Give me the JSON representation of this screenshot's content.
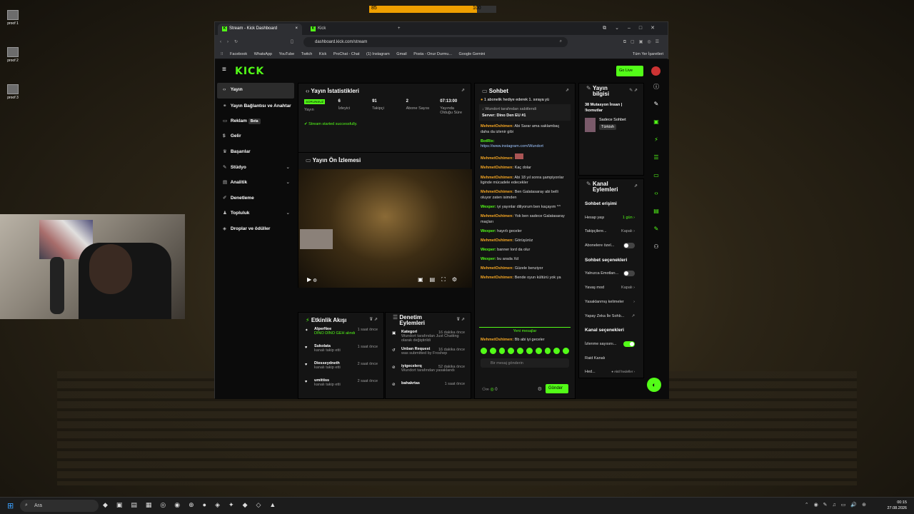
{
  "overlay": {
    "left": "85",
    "right": "100"
  },
  "desktop": {
    "icons": [
      "proof 1",
      "proof 2",
      "proof 3"
    ]
  },
  "browser": {
    "tabs": [
      {
        "label": "Stream - Kick Dashboard",
        "close": "×"
      },
      {
        "label": "Kick"
      }
    ],
    "new_tab": "+",
    "url": "dashboard.kick.com/stream",
    "bookmarks": [
      "Facebook",
      "WhatsApp",
      "YouTube",
      "Twitch",
      "Kick",
      "ProChat - Chat",
      "(1) Instagram",
      "Gmail",
      "Posta - Onur Durmu...",
      "Google Gemini"
    ],
    "bookmarks_folder": "Tüm Yer İşaretleri"
  },
  "kick": {
    "logo": "KICK",
    "go_live": "Go Live",
    "sidebar": [
      {
        "label": "Yayın",
        "icon": "stream-icon",
        "selected": true
      },
      {
        "label": "Yayın Bağlantısı ve Anahtar",
        "icon": "link-icon"
      },
      {
        "label": "Reklam",
        "icon": "ad-icon",
        "badge": "Beta"
      },
      {
        "label": "Gelir",
        "icon": "dollar-icon"
      },
      {
        "label": "Başarılar",
        "icon": "trophy-icon"
      },
      {
        "label": "Stüdyo",
        "icon": "studio-icon",
        "chevron": "⌄"
      },
      {
        "label": "Analitik",
        "icon": "analytics-icon",
        "chevron": "⌄"
      },
      {
        "label": "Denetleme",
        "icon": "moderation-icon"
      },
      {
        "label": "Topluluk",
        "icon": "community-icon",
        "chevron": "⌄"
      },
      {
        "label": "Droplar ve ödüller",
        "icon": "drops-icon"
      }
    ],
    "stats": {
      "title": "Yayın İstatistikleri",
      "badge": "SORUNSUZ",
      "items": [
        {
          "value": "",
          "label": "Yayın"
        },
        {
          "value": "6",
          "label": "İzleyici"
        },
        {
          "value": "91",
          "label": "Takipçi"
        },
        {
          "value": "2",
          "label": "Abone Sayısı"
        },
        {
          "value": "07:13:00",
          "label": "Yayında Olduğu Süre"
        }
      ],
      "status": "Stream started successfully."
    },
    "preview": {
      "title": "Yayın Ön İzlemesi"
    },
    "activity": {
      "title": "Etkinlik Akışı",
      "rows": [
        {
          "name": "AlperNee",
          "sub": "DİNO DİNO GEH alındı",
          "time": "1 saat önce"
        },
        {
          "name": "Sukolata",
          "sub": "kanalı takip etti",
          "time": "1 saat önce"
        },
        {
          "name": "Diesseydneth",
          "sub": "kanalı takip etti",
          "time": "2 saat önce"
        },
        {
          "name": "umittiss",
          "sub": "kanalı takip etti",
          "time": "2 saat önce"
        }
      ]
    },
    "moderation": {
      "title": "Denetim Eylemleri",
      "rows": [
        {
          "name": "Kategori",
          "sub": "Wundort tarafından Just Chatting olarak değiştirildi",
          "time": "16 dakika önce"
        },
        {
          "name": "Unban Request",
          "sub": "was submitted by Froshep",
          "time": "16 dakika önce"
        },
        {
          "name": "iyigecelerq",
          "sub": "Wundort tarafından yasaklandı",
          "time": "52 dakika önce"
        },
        {
          "name": "bahakrtas",
          "sub": "",
          "time": "1 saat önce"
        }
      ]
    },
    "chat": {
      "title": "Sohbet",
      "gift_banner": "1 abonelik hediye ederek 1. sıraya yü",
      "pinned_by": "Wundort tarafından sabitlendi",
      "pinned_msg": "Server: Dino Den EU #1",
      "messages": [
        {
          "user": "MehmetOshimen:",
          "text": "Abi Sarar ama saklambaç daha da izlenir gibi",
          "c": "u"
        },
        {
          "user": "BotRix:",
          "text": "https://www.instagram.com/Wundort",
          "c": "b"
        },
        {
          "user": "MehmetOshimen:",
          "text": "",
          "c": "u"
        },
        {
          "user": "MehmetOshimen:",
          "text": "Kaç dolar",
          "c": "u"
        },
        {
          "user": "MehmetOshimen:",
          "text": "Abi 18 yıl sonra şampiyonlar liginde mücadele edecekler",
          "c": "u"
        },
        {
          "user": "MehmetOshimen:",
          "text": "Ben Galatasaray abi belli oluyor zaten isimden",
          "c": "u"
        },
        {
          "user": "Wexper:",
          "text": "iyi yayınlar diliyorum ben kaçayım ^^",
          "c": "g"
        },
        {
          "user": "MehmetOshimen:",
          "text": "Yok ben sadece Galatasaray maçları",
          "c": "u"
        },
        {
          "user": "Wexper:",
          "text": "hayırlı geceler",
          "c": "g"
        },
        {
          "user": "MehmetOshimen:",
          "text": "Görüşürüz",
          "c": "u"
        },
        {
          "user": "Wexper:",
          "text": "banner lord da olur",
          "c": "g"
        },
        {
          "user": "Wexper:",
          "text": "bu arada Xd",
          "c": "g"
        },
        {
          "user": "MehmetOshimen:",
          "text": "Güzele benziyor",
          "c": "u"
        },
        {
          "user": "MehmetOshimen:",
          "text": "Bende oyun kültürü yok ya",
          "c": "u"
        }
      ],
      "new_messages": "Yeni mesajlar",
      "last": {
        "user": "MehmetOshimen:",
        "text": "Bb abi iyi geceler"
      },
      "input_placeholder": "Bir mesaj gönderin",
      "count": "0",
      "send": "Gönder"
    },
    "info": {
      "title": "Yayın bilgisi",
      "stream_title": "38 Mutasyon İnsan | !komutlar",
      "category": "Sadece Sohbet",
      "language": "Türkish"
    },
    "channel": {
      "title": "Kanal Eylemleri",
      "chat_access": "Sohbet erişimi",
      "rows1": [
        {
          "label": "Hesap yaşı",
          "value": "1 gün ›"
        },
        {
          "label": "Takipçilere...",
          "value": "Kapalı ›"
        },
        {
          "label": "Abonelere özel...",
          "toggle": false
        }
      ],
      "chat_options": "Sohbet seçenekleri",
      "rows2": [
        {
          "label": "Yalnızca Emotları...",
          "toggle": false
        },
        {
          "label": "Yavaş mod",
          "value": "Kapalı ›"
        },
        {
          "label": "Yasaklanmış kelimeler",
          "value": "›"
        },
        {
          "label": "Yapay Zeka İle Sohb...",
          "value": "↗"
        }
      ],
      "channel_options": "Kanal seçenekleri",
      "rows3": [
        {
          "label": "İzlenme sayısını...",
          "toggle": true
        },
        {
          "label": "Raid Kanalı",
          "value": ""
        },
        {
          "label": "Hed...",
          "value": "● Aktif hedefler ›"
        }
      ]
    }
  },
  "taskbar": {
    "search": "Ara",
    "time": "00:15",
    "date": "27.08.2026"
  }
}
